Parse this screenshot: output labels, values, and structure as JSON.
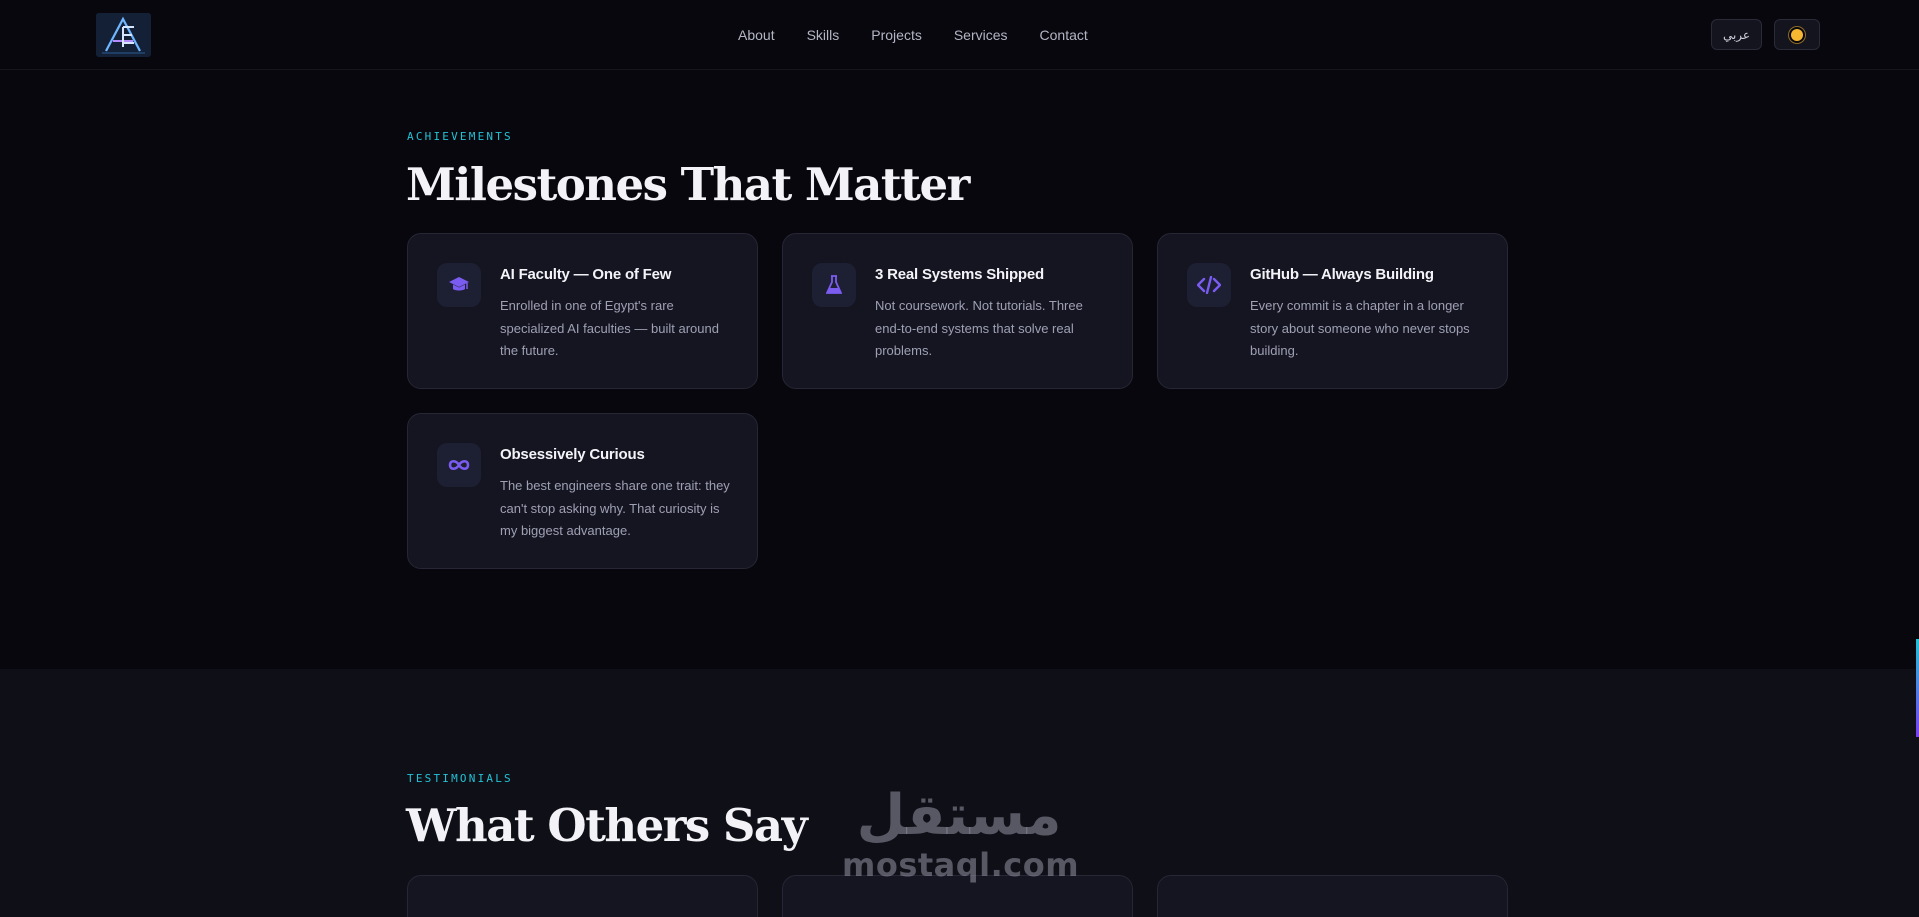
{
  "nav": {
    "logo_text": "AE",
    "links": [
      "About",
      "Skills",
      "Projects",
      "Services",
      "Contact"
    ],
    "lang_label": "عربي",
    "theme_icon": "sun-icon"
  },
  "achievements": {
    "eyebrow": "ACHIEVEMENTS",
    "heading": "Milestones That Matter",
    "cards": [
      {
        "icon": "graduation-cap-icon",
        "title": "AI Faculty — One of Few",
        "text": "Enrolled in one of Egypt's rare specialized AI faculties — built around the future."
      },
      {
        "icon": "flask-icon",
        "title": "3 Real Systems Shipped",
        "text": "Not coursework. Not tutorials. Three end-to-end systems that solve real problems."
      },
      {
        "icon": "code-icon",
        "title": "GitHub — Always Building",
        "text": "Every commit is a chapter in a longer story about someone who never stops building."
      },
      {
        "icon": "infinity-icon",
        "title": "Obsessively Curious",
        "text": "The best engineers share one trait: they can't stop asking why. That curiosity is my biggest advantage."
      }
    ]
  },
  "testimonials": {
    "eyebrow": "TESTIMONIALS",
    "heading": "What Others Say"
  },
  "watermark": {
    "arabic": "مستقل",
    "latin": "mostaql.com"
  },
  "colors": {
    "background": "#07070d",
    "accent_cyan": "#22c3d6",
    "accent_purple": "#6d4ee6",
    "card_bg": "#151522"
  }
}
